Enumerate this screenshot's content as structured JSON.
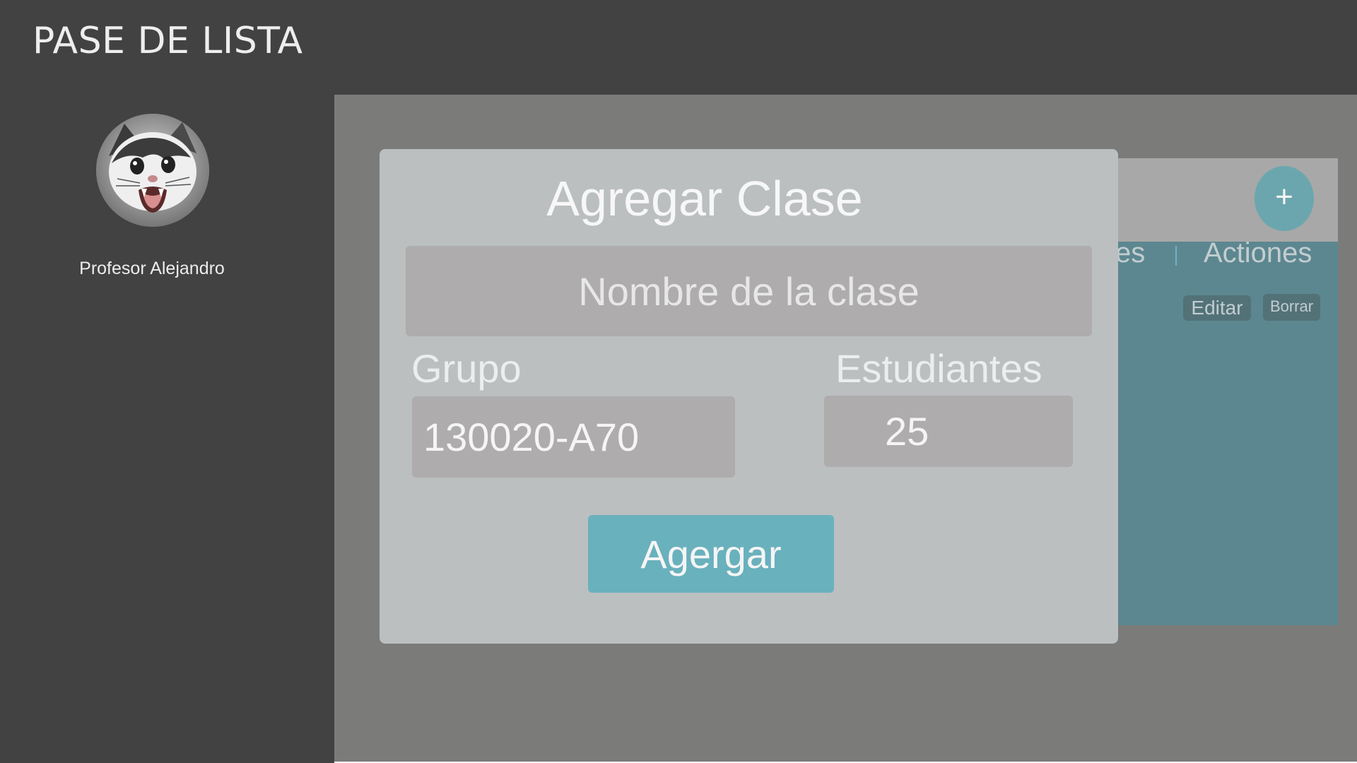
{
  "app": {
    "title": "PASE DE LISTA"
  },
  "sidebar": {
    "avatar_icon": "cat-photo-avatar",
    "profile_name": "Profesor Alejandro"
  },
  "background_table": {
    "add_button_label": "+",
    "columns": [
      "es",
      "Actiones"
    ],
    "row_actions": {
      "edit_label": "Editar",
      "delete_label": "Borrar"
    }
  },
  "modal": {
    "title": "Agregar Clase",
    "class_name": {
      "placeholder": "Nombre de la clase",
      "value": ""
    },
    "group": {
      "label": "Grupo",
      "value": "130020-A70"
    },
    "students": {
      "label": "Estudiantes",
      "value": "25"
    },
    "submit_label": "Agergar"
  },
  "colors": {
    "header_bg": "#424242",
    "main_bg": "#7b7b7a",
    "modal_bg": "#bbbfc0",
    "input_bg": "#aeacac",
    "accent": "#69b1bd",
    "card_bg": "#5c8790"
  }
}
